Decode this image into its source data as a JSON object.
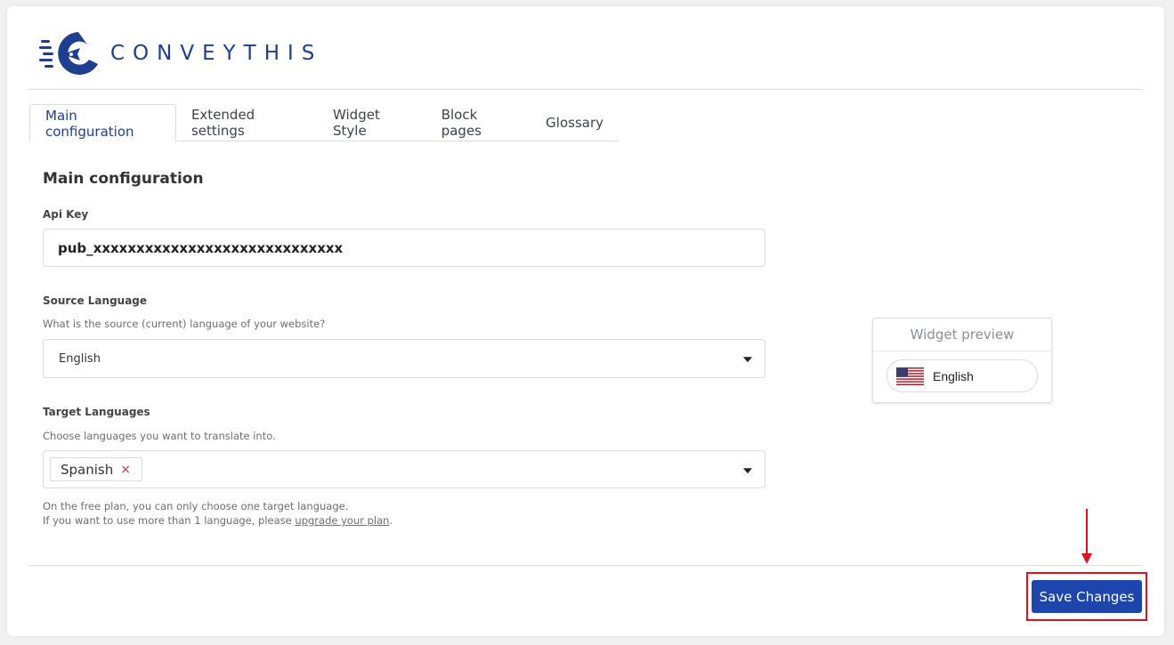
{
  "brand": {
    "name": "CONVEYTHIS"
  },
  "tabs": [
    {
      "label": "Main configuration",
      "active": true
    },
    {
      "label": "Extended settings",
      "active": false
    },
    {
      "label": "Widget Style",
      "active": false
    },
    {
      "label": "Block pages",
      "active": false
    },
    {
      "label": "Glossary",
      "active": false
    }
  ],
  "main": {
    "title": "Main configuration",
    "api_key": {
      "label": "Api Key",
      "value": "pub_xxxxxxxxxxxxxxxxxxxxxxxxxxxxx"
    },
    "source_language": {
      "label": "Source Language",
      "hint": "What is the source (current) language of your website?",
      "value": "English"
    },
    "target_languages": {
      "label": "Target Languages",
      "hint": "Choose languages you want to translate into.",
      "selected": [
        "Spanish"
      ],
      "remove_glyph": "×",
      "note_line1": "On the free plan, you can only choose one target language.",
      "note_line2_prefix": "If you want to use more than 1 language, please ",
      "note_link": "upgrade your plan",
      "note_line2_suffix": "."
    }
  },
  "widget_preview": {
    "title": "Widget preview",
    "language": "English",
    "flag_icon": "us-flag-icon"
  },
  "footer": {
    "save_label": "Save Changes"
  },
  "colors": {
    "brand": "#1e3e92",
    "save_button": "#1e45ac",
    "highlight": "#e0101c"
  }
}
